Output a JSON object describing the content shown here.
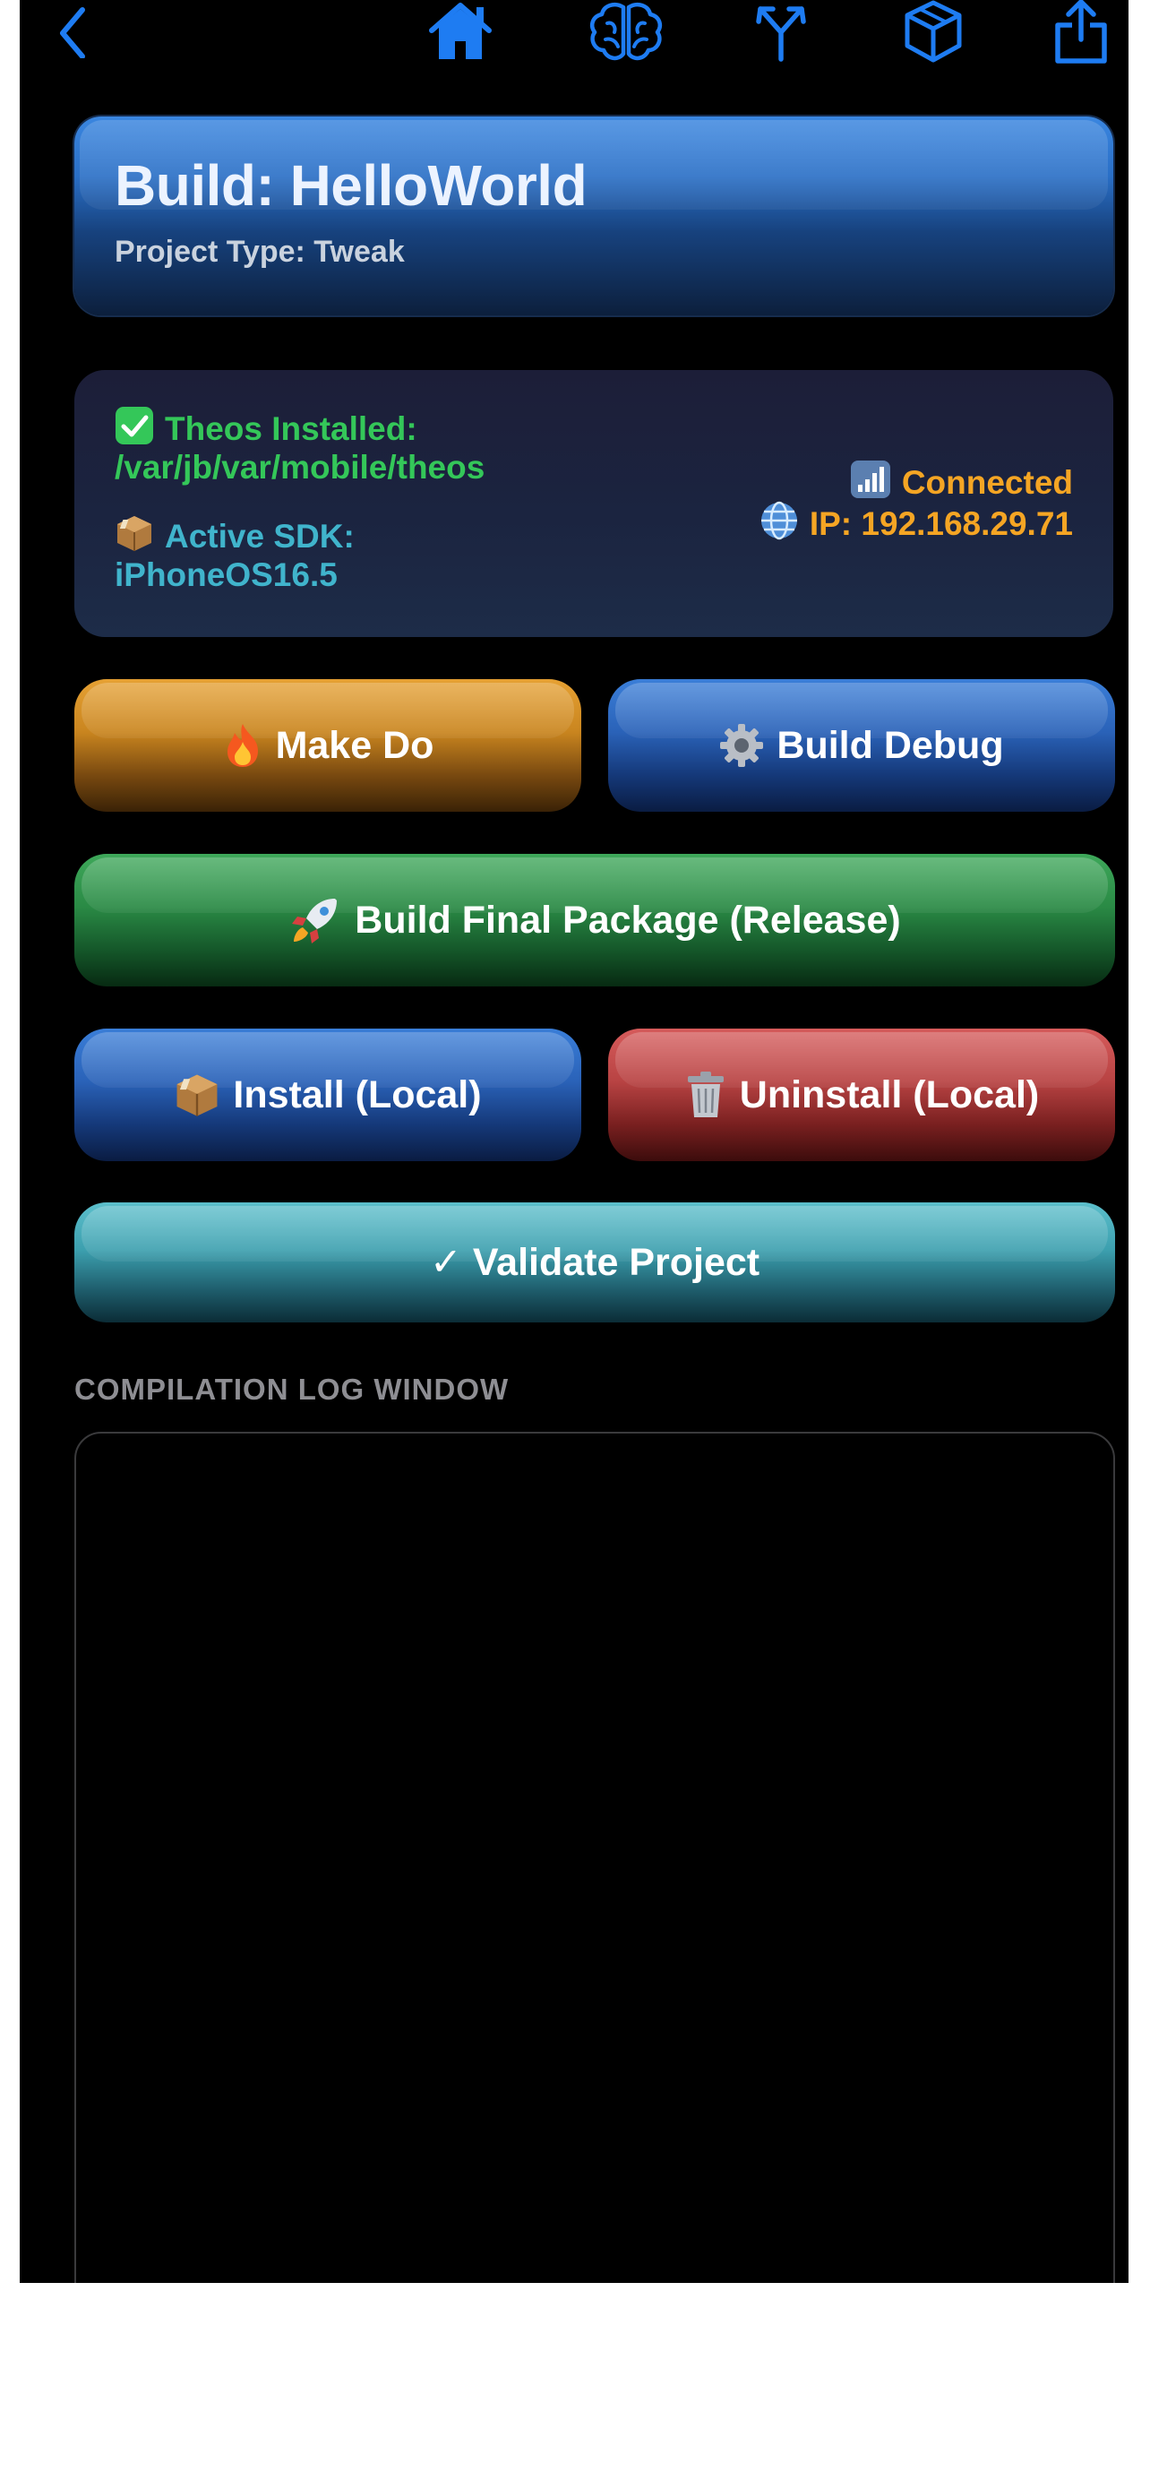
{
  "nav": {
    "icons": [
      "chevron-left-icon",
      "home-icon",
      "brain-icon",
      "branch-icon",
      "cube-icon",
      "share-icon"
    ],
    "accent": "#1e7cf2"
  },
  "header": {
    "title": "Build: HelloWorld",
    "subtitle": "Project Type: Tweak"
  },
  "status": {
    "theos_label": "Theos Installed:",
    "theos_path": "/var/jb/var/mobile/theos",
    "sdk_label": "Active SDK:",
    "sdk_value": "iPhoneOS16.5",
    "connection": "Connected",
    "ip": "IP: 192.168.29.71",
    "green": "#34c759",
    "teal": "#40b4cc",
    "orange": "#f5a524"
  },
  "actions": {
    "make_do": "Make Do",
    "build_debug": "Build Debug",
    "build_final": "Build Final Package (Release)",
    "install_local": "Install (Local)",
    "uninstall_local": "Uninstall (Local)",
    "validate": "✓ Validate Project"
  },
  "log": {
    "label": "COMPILATION LOG WINDOW",
    "content": ""
  }
}
